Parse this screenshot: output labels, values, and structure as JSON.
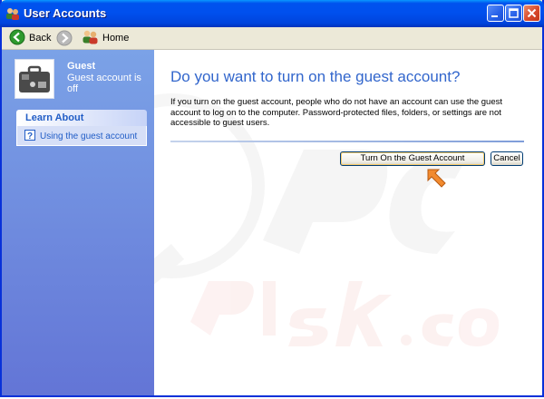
{
  "window": {
    "title": "User Accounts"
  },
  "toolbar": {
    "back_label": "Back",
    "home_label": "Home"
  },
  "sidebar": {
    "user": {
      "name": "Guest",
      "status": "Guest account is off"
    },
    "learn_about": {
      "header": "Learn About",
      "items": [
        {
          "label": "Using the guest account",
          "icon": "help-icon"
        }
      ]
    }
  },
  "main": {
    "heading": "Do you want to turn on the guest account?",
    "description": "If you turn on the guest account, people who do not have an account can use the guest account to log on to the computer. Password-protected files, folders, or settings are not accessible to guest users.",
    "buttons": {
      "turn_on": "Turn On the Guest Account",
      "cancel": "Cancel"
    }
  },
  "colors": {
    "titlebar": "#0054e3",
    "sidebar": "#7ba2e7",
    "heading": "#3266cc",
    "link": "#215dc6",
    "pointer": "#f28a2e"
  }
}
